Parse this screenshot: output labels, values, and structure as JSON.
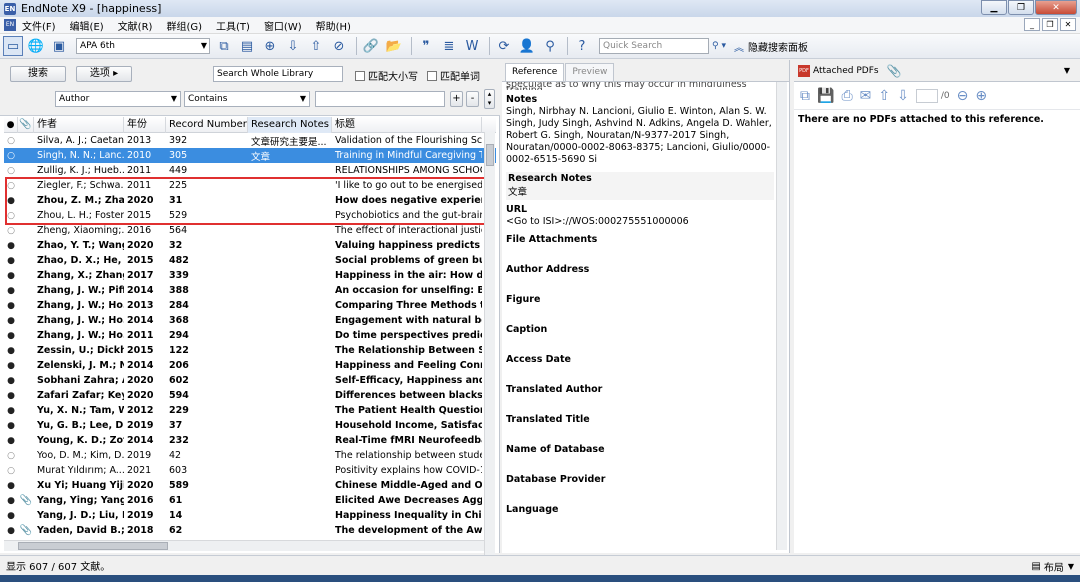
{
  "window": {
    "title": "EndNote X9 - [happiness]",
    "app_icon_text": "EN"
  },
  "menu": [
    "文件(F)",
    "编辑(E)",
    "文献(R)",
    "群组(G)",
    "工具(T)",
    "窗口(W)",
    "帮助(H)"
  ],
  "toolbar": {
    "style": "APA 6th",
    "quick_search_placeholder": "Quick Search",
    "hide_search_label": "隐藏搜索面板"
  },
  "search": {
    "search_button": "搜索",
    "options_button": "选项",
    "scope": "Search Whole Library",
    "match_case": "匹配大小写",
    "match_words": "匹配单词",
    "field": "Author",
    "operator": "Contains",
    "value": ""
  },
  "table": {
    "headers": {
      "author": "作者",
      "year": "年份",
      "record": "Record Number",
      "notes": "Research Notes",
      "title": "标题"
    },
    "rows": [
      {
        "dot": "○",
        "att": "",
        "author": "Silva, A. J.; Caetan...",
        "year": "2013",
        "rec": "392",
        "note": "文章研究主要是...",
        "title": "Validation of the Flourishing Scale",
        "bold": false,
        "sel": false
      },
      {
        "dot": "○",
        "att": "",
        "author": "Singh, N. N.; Lanc...",
        "year": "2010",
        "rec": "305",
        "note": "文章",
        "title": "Training in Mindful Caregiving Tr",
        "bold": false,
        "sel": true
      },
      {
        "dot": "○",
        "att": "",
        "author": "Zullig, K. J.; Hueb...",
        "year": "2011",
        "rec": "449",
        "note": "",
        "title": "RELATIONSHIPS AMONG SCHOO",
        "bold": false,
        "sel": false
      },
      {
        "dot": "○",
        "att": "",
        "author": "Ziegler, F.; Schwa...",
        "year": "2011",
        "rec": "225",
        "note": "",
        "title": "'I like to go out to be energised by",
        "bold": false,
        "sel": false
      },
      {
        "dot": "●",
        "att": "",
        "author": "Zhou, Z. M.; Zhan...",
        "year": "2020",
        "rec": "31",
        "note": "",
        "title": "How does negative experience s",
        "bold": true,
        "sel": false
      },
      {
        "dot": "○",
        "att": "",
        "author": "Zhou, L. H.; Foster...",
        "year": "2015",
        "rec": "529",
        "note": "",
        "title": "Psychobiotics and the gut-brain a",
        "bold": false,
        "sel": false
      },
      {
        "dot": "○",
        "att": "",
        "author": "Zheng, Xiaoming;...",
        "year": "2016",
        "rec": "564",
        "note": "",
        "title": "The effect of interactional justice o",
        "bold": false,
        "sel": false
      },
      {
        "dot": "●",
        "att": "",
        "author": "Zhao, Y. T.; Wang...",
        "year": "2020",
        "rec": "32",
        "note": "",
        "title": "Valuing happiness predicts highe",
        "bold": true,
        "sel": false
      },
      {
        "dot": "●",
        "att": "",
        "author": "Zhao, D. X.; He, B...",
        "year": "2015",
        "rec": "482",
        "note": "",
        "title": "Social problems of green buildin",
        "bold": true,
        "sel": false
      },
      {
        "dot": "●",
        "att": "",
        "author": "Zhang, X.; Zhang,...",
        "year": "2017",
        "rec": "339",
        "note": "",
        "title": "Happiness in the air: How does a",
        "bold": true,
        "sel": false
      },
      {
        "dot": "●",
        "att": "",
        "author": "Zhang, J. W.; Piff,...",
        "year": "2014",
        "rec": "388",
        "note": "",
        "title": "An occasion for unselfing: Beaut",
        "bold": true,
        "sel": false
      },
      {
        "dot": "●",
        "att": "",
        "author": "Zhang, J. W.; Ho...",
        "year": "2013",
        "rec": "284",
        "note": "",
        "title": "Comparing Three Methods to M",
        "bold": true,
        "sel": false
      },
      {
        "dot": "●",
        "att": "",
        "author": "Zhang, J. W.; Ho...",
        "year": "2014",
        "rec": "368",
        "note": "",
        "title": "Engagement with natural beauty",
        "bold": true,
        "sel": false
      },
      {
        "dot": "●",
        "att": "",
        "author": "Zhang, J. W.; Ho...",
        "year": "2011",
        "rec": "294",
        "note": "",
        "title": "Do time perspectives predict un",
        "bold": true,
        "sel": false
      },
      {
        "dot": "●",
        "att": "",
        "author": "Zessin, U.; Dickha...",
        "year": "2015",
        "rec": "122",
        "note": "",
        "title": "The Relationship Between Self-C",
        "bold": true,
        "sel": false
      },
      {
        "dot": "●",
        "att": "",
        "author": "Zelenski, J. M.; Ni...",
        "year": "2014",
        "rec": "206",
        "note": "",
        "title": "Happiness and Feeling Connecte",
        "bold": true,
        "sel": false
      },
      {
        "dot": "●",
        "att": "",
        "author": "Sobhani Zahra; A...",
        "year": "2020",
        "rec": "602",
        "note": "",
        "title": "Self-Efficacy, Happiness and Psy",
        "bold": true,
        "sel": false
      },
      {
        "dot": "●",
        "att": "",
        "author": "Zafari Zafar; Key...",
        "year": "2020",
        "rec": "594",
        "note": "",
        "title": "Differences between blacks and",
        "bold": true,
        "sel": false
      },
      {
        "dot": "●",
        "att": "",
        "author": "Yu, X. N.; Tam, W...",
        "year": "2012",
        "rec": "229",
        "note": "",
        "title": "The Patient Health Questionnair",
        "bold": true,
        "sel": false
      },
      {
        "dot": "●",
        "att": "",
        "author": "Yu, G. B.; Lee, D. ...",
        "year": "2019",
        "rec": "37",
        "note": "",
        "title": "Household Income, Satisfaction",
        "bold": true,
        "sel": false
      },
      {
        "dot": "●",
        "att": "",
        "author": "Young, K. D.; Zot...",
        "year": "2014",
        "rec": "232",
        "note": "",
        "title": "Real-Time fMRI Neurofeedback",
        "bold": true,
        "sel": false
      },
      {
        "dot": "○",
        "att": "",
        "author": "Yoo, D. M.; Kim, D...",
        "year": "2019",
        "rec": "42",
        "note": "",
        "title": "The relationship between student",
        "bold": false,
        "sel": false
      },
      {
        "dot": "○",
        "att": "",
        "author": "Murat Yıldırım; A...",
        "year": "2021",
        "rec": "603",
        "note": "",
        "title": "Positivity explains how COVID-19",
        "bold": false,
        "sel": false
      },
      {
        "dot": "●",
        "att": "",
        "author": "Xu Yi; Huang Yijie",
        "year": "2020",
        "rec": "589",
        "note": "",
        "title": "Chinese Middle-Aged and Older",
        "bold": true,
        "sel": false
      },
      {
        "dot": "●",
        "att": "📎",
        "author": "Yang, Ying; Yang, ...",
        "year": "2016",
        "rec": "61",
        "note": "",
        "title": "Elicited Awe Decreases Aggressi",
        "bold": true,
        "sel": false
      },
      {
        "dot": "●",
        "att": "",
        "author": "Yang, J. D.; Liu, K...",
        "year": "2019",
        "rec": "14",
        "note": "",
        "title": "Happiness Inequality in China",
        "bold": true,
        "sel": false
      },
      {
        "dot": "●",
        "att": "📎",
        "author": "Yaden, David B.; ...",
        "year": "2018",
        "rec": "62",
        "note": "",
        "title": "The development of the Awe Ex",
        "bold": true,
        "sel": false
      }
    ]
  },
  "reference": {
    "tab_reference": "Reference",
    "tab_preview": "Preview",
    "top_snippet": "speculate as to why this may occur in mindfulness training.",
    "notes_label": "Notes",
    "notes_text": "Singh, Nirbhay N. Lancioni, Giulio E. Winton, Alan S. W. Singh, Judy Singh, Ashvind N. Adkins, Angela D. Wahler, Robert G. Singh, Nouratan/N-9377-2017 Singh, Nouratan/0000-0002-8063-8375; Lancioni, Giulio/0000-0002-6515-5690 Si",
    "research_notes_label": "Research Notes",
    "research_notes_value": "文章",
    "url_label": "URL",
    "url_value": "<Go to ISI>://WOS:000275551000006",
    "fields": [
      "File Attachments",
      "Author Address",
      "Figure",
      "Caption",
      "Access Date",
      "Translated Author",
      "Translated Title",
      "Name of Database",
      "Database Provider",
      "Language"
    ]
  },
  "pdf": {
    "tab_label": "Attached PDFs",
    "page_suffix": "/0",
    "message": "There are no PDFs attached to this reference."
  },
  "status": {
    "count_text": "显示 607 / 607 文献。",
    "layout_label": "布局"
  }
}
